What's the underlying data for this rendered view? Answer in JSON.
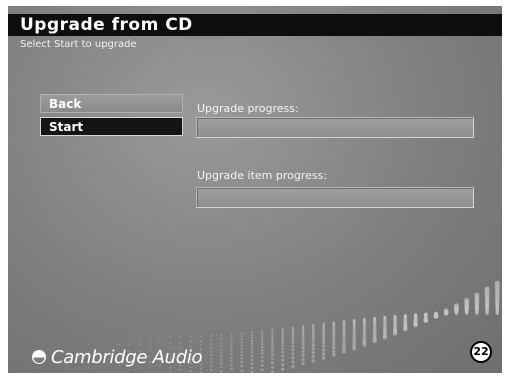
{
  "header": {
    "title": "Upgrade from CD",
    "subtitle": "Select Start to upgrade"
  },
  "menu": {
    "back_label": "Back",
    "start_label": "Start",
    "selected": "Start"
  },
  "progress": {
    "upgrade_label": "Upgrade progress:",
    "upgrade_value": 0,
    "item_label": "Upgrade item progress:",
    "item_value": 0
  },
  "brand": {
    "logo_text": "Cambridge Audio",
    "logo_icon": "cambridge-audio-logo-icon"
  },
  "page_number": "22",
  "colors": {
    "background": "#7f7f7f",
    "title_bar": "#0e0e0e",
    "selected_button": "#141414",
    "button": "#8f8f8f",
    "text": "#ffffff"
  }
}
